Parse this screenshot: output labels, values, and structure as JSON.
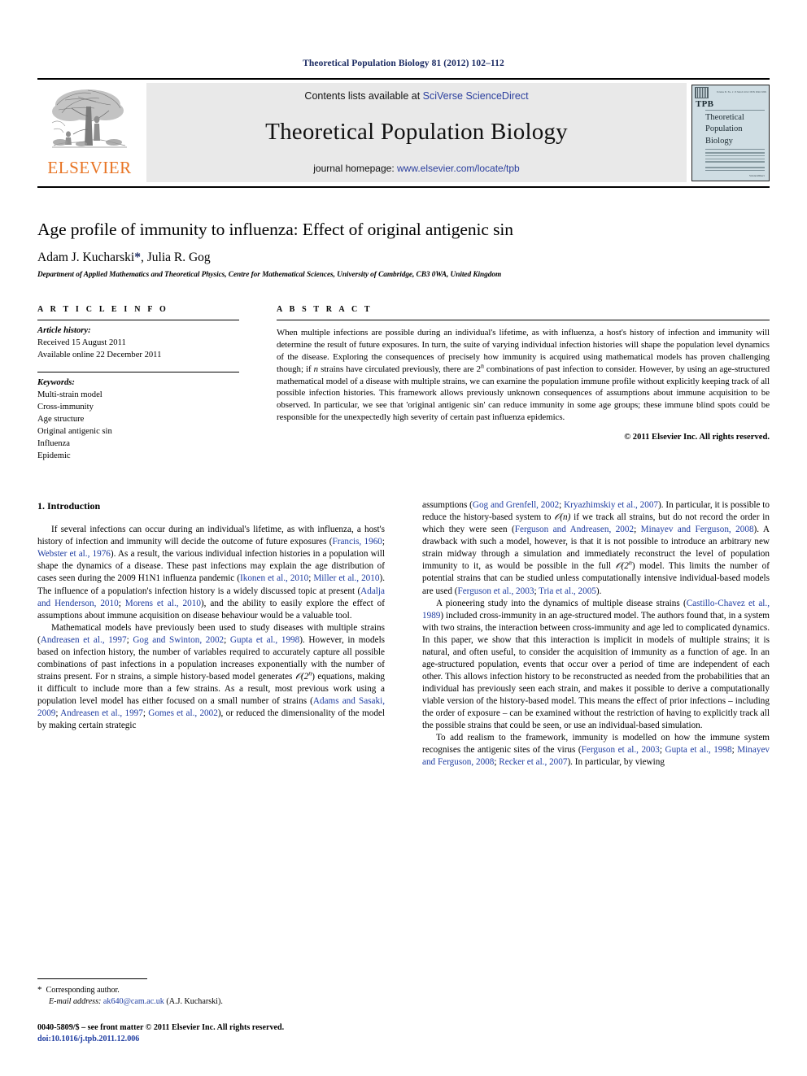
{
  "running_head": "Theoretical Population Biology 81 (2012) 102–112",
  "masthead": {
    "publisher_logo_text": "ELSEVIER",
    "contents_prefix": "Contents lists available at ",
    "contents_link": "SciVerse ScienceDirect",
    "journal_name": "Theoretical Population Biology",
    "homepage_prefix": "journal homepage: ",
    "homepage_link": "www.elsevier.com/locate/tpb",
    "cover": {
      "abbrev": "TPB",
      "title_line1": "Theoretical",
      "title_line2": "Population",
      "title_line3": "Biology",
      "top_left_label": "ISSN",
      "top_right_label": "Volume 81   No. 2   15 March 2012   ISSN 0040-5809",
      "publisher_footer": "ScienceDirect"
    }
  },
  "article": {
    "title": "Age profile of immunity to influenza: Effect of original antigenic sin",
    "authors": "Adam J. Kucharski",
    "author_star": "*",
    "authors_rest": ", Julia R. Gog",
    "affiliation": "Department of Applied Mathematics and Theoretical Physics, Centre for Mathematical Sciences, University of Cambridge, CB3 0WA, United Kingdom"
  },
  "article_info": {
    "heading": "A R T I C L E    I N F O",
    "history_label": "Article history:",
    "received": "Received 15 August 2011",
    "available": "Available online 22 December 2011",
    "keywords_label": "Keywords:",
    "keywords": [
      "Multi-strain model",
      "Cross-immunity",
      "Age structure",
      "Original antigenic sin",
      "Influenza",
      "Epidemic"
    ]
  },
  "abstract": {
    "heading": "A B S T R A C T",
    "text_part1": "When multiple infections are possible during an individual's lifetime, as with influenza, a host's history of infection and immunity will determine the result of future exposures. In turn, the suite of varying individual infection histories will shape the population level dynamics of the disease. Exploring the consequences of precisely how immunity is acquired using mathematical models has proven challenging though; if ",
    "math_n": "n",
    "text_part2": " strains have circulated previously, there are 2",
    "math_exp": "n",
    "text_part3": " combinations of past infection to consider. However, by using an age-structured mathematical model of a disease with multiple strains, we can examine the population immune profile without explicitly keeping track of all possible infection histories. This framework allows previously unknown consequences of assumptions about immune acquisition to be observed. In particular, we see that 'original antigenic sin' can reduce immunity in some age groups; these immune blind spots could be responsible for the unexpectedly high severity of certain past influenza epidemics.",
    "copyright": "© 2011 Elsevier Inc. All rights reserved."
  },
  "body": {
    "section_number_title": "1.  Introduction",
    "left_col": {
      "p1_a": "If several infections can occur during an individual's lifetime, as with influenza, a host's history of infection and immunity will decide the outcome of future exposures (",
      "p1_cit1": "Francis, 1960",
      "p1_b": "; ",
      "p1_cit2": "Webster et al., 1976",
      "p1_c": "). As a result, the various individual infection histories in a population will shape the dynamics of a disease. These past infections may explain the age distribution of cases seen during the 2009 H1N1 influenza pandemic (",
      "p1_cit3": "Ikonen et al., 2010",
      "p1_d": "; ",
      "p1_cit4": "Miller et al., 2010",
      "p1_e": "). The influence of a population's infection history is a widely discussed topic at present (",
      "p1_cit5": "Adalja and Henderson, 2010",
      "p1_f": "; ",
      "p1_cit6": "Morens et al., 2010",
      "p1_g": "), and the ability to easily explore the effect of assumptions about immune acquisition on disease behaviour would be a valuable tool.",
      "p2_a": "Mathematical models have previously been used to study diseases with multiple strains (",
      "p2_cit1": "Andreasen et al., 1997",
      "p2_b": "; ",
      "p2_cit2": "Gog and Swinton, 2002",
      "p2_c": "; ",
      "p2_cit3": "Gupta et al., 1998",
      "p2_d": "). However, in models based on infection history, the number of variables required to accurately capture all possible combinations of past infections in a population increases exponentially with the number of strains present. For n strains, a simple history-based model generates ",
      "p2_math": "𝒪(2",
      "p2_math_sup": "n",
      "p2_e": ") equations, making it difficult to include more than a few strains. As a result, most previous work using a population level model has either focused on a small number of strains (",
      "p2_cit4": "Adams and Sasaki, 2009",
      "p2_f": "; ",
      "p2_cit5": "Andreasen et al., 1997",
      "p2_g": "; ",
      "p2_cit6": "Gomes et al., 2002",
      "p2_h": "), or reduced the dimensionality of the model by making certain strategic"
    },
    "right_col": {
      "p1_a": "assumptions (",
      "p1_cit1": "Gog and Grenfell, 2002",
      "p1_b": "; ",
      "p1_cit2": "Kryazhimskiy et al., 2007",
      "p1_c": "). In particular, it is possible to reduce the history-based system to ",
      "p1_math1": "𝒪(n)",
      "p1_d": " if we track all strains, but do not record the order in which they were seen (",
      "p1_cit3": "Ferguson and Andreasen, 2002",
      "p1_e": "; ",
      "p1_cit4": "Minayev and Ferguson, 2008",
      "p1_f": "). A drawback with such a model, however, is that it is not possible to introduce an arbitrary new strain midway through a simulation and immediately reconstruct the level of population immunity to it, as would be possible in the full ",
      "p1_math2": "𝒪(2",
      "p1_math2_sup": "n",
      "p1_g": ") model. This limits the number of potential strains that can be studied unless computationally intensive individual-based models are used (",
      "p1_cit5": "Ferguson et al., 2003",
      "p1_h": "; ",
      "p1_cit6": "Tria et al., 2005",
      "p1_i": ").",
      "p2_a": "A pioneering study into the dynamics of multiple disease strains (",
      "p2_cit1": "Castillo-Chavez et al., 1989",
      "p2_b": ") included cross-immunity in an age-structured model. The authors found that, in a system with two strains, the interaction between cross-immunity and age led to complicated dynamics. In this paper, we show that this interaction is implicit in models of multiple strains; it is natural, and often useful, to consider the acquisition of immunity as a function of age. In an age-structured population, events that occur over a period of time are independent of each other. This allows infection history to be reconstructed as needed from the probabilities that an individual has previously seen each strain, and makes it possible to derive a computationally viable version of the history-based model. This means the effect of prior infections – including the order of exposure – can be examined without the  restriction of having to explicitly track all the possible strains that could be seen, or use an individual-based simulation.",
      "p3_a": "To add realism to the framework, immunity is modelled on how the immune system recognises the antigenic sites of the virus (",
      "p3_cit1": "Ferguson et al., 2003",
      "p3_b": "; ",
      "p3_cit2": "Gupta et al., 1998",
      "p3_c": "; ",
      "p3_cit3": "Minayev and Ferguson, 2008",
      "p3_d": "; ",
      "p3_cit4": "Recker et al., 2007",
      "p3_e": "). In particular, by viewing"
    }
  },
  "footer": {
    "corresponding_star": "*",
    "corresponding_label": "Corresponding author.",
    "email_label": "E-mail address:",
    "email": "ak640@cam.ac.uk",
    "email_suffix": "(A.J. Kucharski).",
    "imprint_line": "0040-5809/$ – see front matter © 2011 Elsevier Inc. All rights reserved.",
    "doi_line": "doi:10.1016/j.tpb.2011.12.006"
  },
  "colors": {
    "citation_blue": "#1f3da1",
    "link_blue": "#2b3f9e",
    "running_head_navy": "#1a2a62",
    "elsevier_orange": "#E87424",
    "banner_gray": "#e9e9e9"
  }
}
